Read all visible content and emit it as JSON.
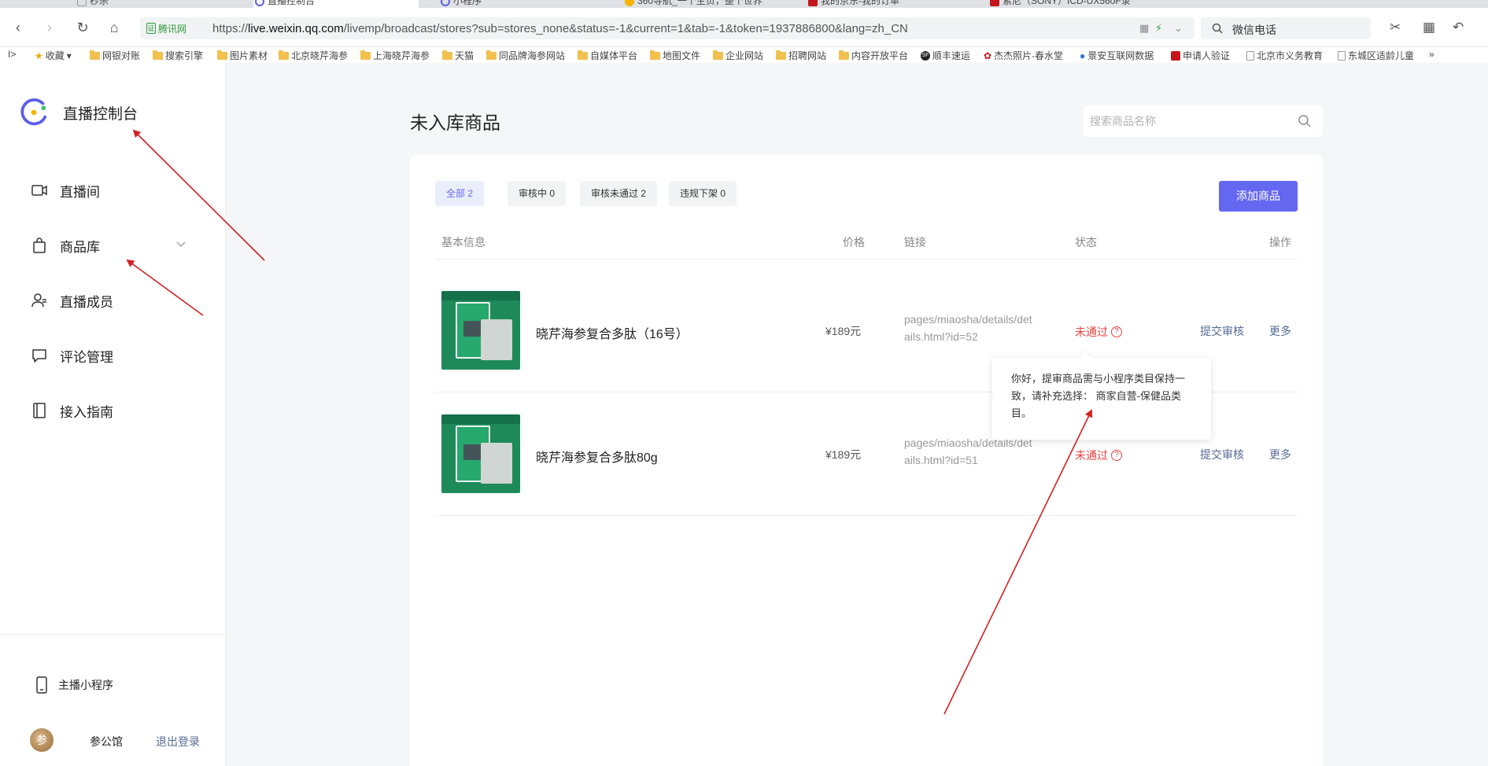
{
  "browser": {
    "tabs": [
      {
        "label": "秒杀",
        "active": false
      },
      {
        "label": "直播控制台",
        "active": true
      },
      {
        "label": "小程序",
        "active": false
      },
      {
        "label": "360导航_一个主页，整个世界",
        "active": false
      },
      {
        "label": "我的京东-我的订单",
        "active": false
      },
      {
        "label": "索尼（SONY）ICD-UX560F录",
        "active": false
      }
    ],
    "secure_label": "腾讯网",
    "url_prefix": "https://",
    "url_host": "live.weixin.qq.com",
    "url_path": "/livemp/broadcast/stores?sub=stores_none&status=-1&current=1&tab=-1&token=1937886800&lang=zh_CN",
    "search_text": "微信电话"
  },
  "bookmarks": {
    "favorites": "收藏",
    "items": [
      "网银对账",
      "搜索引擎",
      "图片素材",
      "北京晓芹海参",
      "上海晓芹海参",
      "天猫",
      "同品牌海参网站",
      "自媒体平台",
      "地图文件",
      "企业网站",
      "招聘网站",
      "内容开放平台",
      "顺丰速运",
      "杰杰照片-春水堂",
      "景安互联网数据",
      "申请人验证",
      "北京市义务教育",
      "东城区适龄儿童"
    ],
    "more": "»"
  },
  "sidebar": {
    "brand_title": "直播控制台",
    "brand_colors": {
      "ring": "#5b5fe8",
      "green": "#3bc46c",
      "yellow": "#f5b400"
    },
    "nav": [
      {
        "label": "直播间",
        "icon": "video-icon"
      },
      {
        "label": "商品库",
        "icon": "shopping-bag-icon"
      },
      {
        "label": "直播成员",
        "icon": "members-icon"
      },
      {
        "label": "评论管理",
        "icon": "comment-icon"
      },
      {
        "label": "接入指南",
        "icon": "guide-book-icon"
      }
    ],
    "mini_program_label": "主播小程序",
    "avatar_text": "参",
    "username": "参公馆",
    "logout_label": "退出登录"
  },
  "main": {
    "title": "未入库商品",
    "search_placeholder": "搜索商品名称",
    "filters": [
      {
        "label": "全部 2",
        "active": true
      },
      {
        "label": "审核中 0",
        "active": false
      },
      {
        "label": "审核未通过 2",
        "active": false
      },
      {
        "label": "违规下架 0",
        "active": false
      }
    ],
    "add_button": "添加商品",
    "columns": {
      "info": "基本信息",
      "price": "价格",
      "link": "链接",
      "status": "状态",
      "ops": "操作"
    },
    "rows": [
      {
        "name": "晓芹海参复合多肽（16号）",
        "price": "¥189元",
        "link": "pages/miaosha/details/details.html?id=52",
        "status": "未通过",
        "submit": "提交审核",
        "more": "更多"
      },
      {
        "name": "晓芹海参复合多肽80g",
        "price": "¥189元",
        "link": "pages/miaosha/details/details.html?id=51",
        "status": "未通过",
        "submit": "提交审核",
        "more": "更多"
      }
    ],
    "tooltip": "你好，提审商品需与小程序类目保持一致，请补充选择： 商家自营-保健品类目。"
  },
  "colors": {
    "accent": "#6467f0",
    "error": "#e64340",
    "link": "#576b95",
    "annotation": "#d42020"
  }
}
